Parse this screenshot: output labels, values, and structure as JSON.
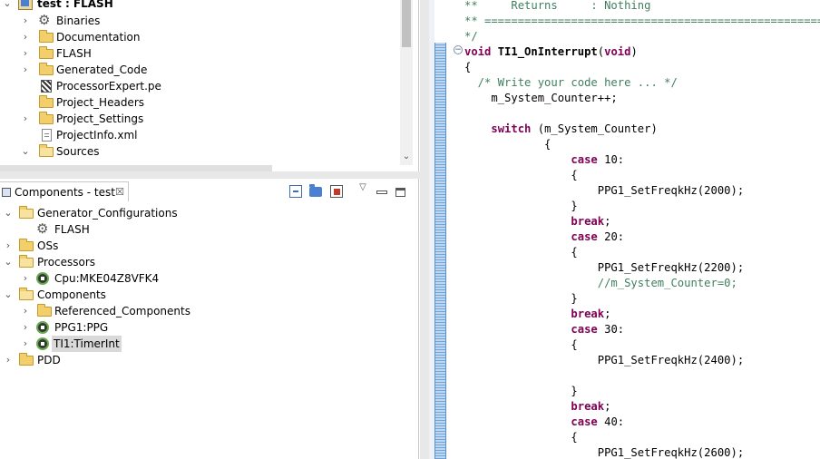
{
  "project_tree": {
    "root": {
      "name": "test",
      "config": ": FLASH"
    },
    "items": [
      {
        "label": "Binaries",
        "icon": "gear-icon"
      },
      {
        "label": "Documentation",
        "icon": "folder-icon"
      },
      {
        "label": "FLASH",
        "icon": "folder-icon"
      },
      {
        "label": "Generated_Code",
        "icon": "folder-icon"
      },
      {
        "label": "ProcessorExpert.pe",
        "icon": "pe-file-icon"
      },
      {
        "label": "Project_Headers",
        "icon": "folder-icon"
      },
      {
        "label": "Project_Settings",
        "icon": "folder-icon"
      },
      {
        "label": "ProjectInfo.xml",
        "icon": "xml-file-icon"
      },
      {
        "label": "Sources",
        "icon": "folder-icon"
      }
    ]
  },
  "components_view": {
    "tab_label": "Components - test",
    "tree": [
      {
        "label": "Generator_Configurations",
        "icon": "folder-icon"
      },
      {
        "label": "FLASH",
        "icon": "gear-icon"
      },
      {
        "label": "OSs",
        "icon": "folder-icon"
      },
      {
        "label": "Processors",
        "icon": "folder-icon"
      },
      {
        "label": "Cpu:MKE04Z8VFK4",
        "icon": "cpu-component-icon"
      },
      {
        "label": "Components",
        "icon": "folder-icon"
      },
      {
        "label": "Referenced_Components",
        "icon": "folder-icon"
      },
      {
        "label": "PPG1:PPG",
        "icon": "ppg-component-icon"
      },
      {
        "label": "TI1:TimerInt",
        "icon": "timer-component-icon",
        "selected": true
      },
      {
        "label": "PDD",
        "icon": "folder-icon"
      }
    ]
  },
  "editor": {
    "lines": [
      "**     Returns     : Nothing",
      "** ===================================================================",
      "*/",
      "void TI1_OnInterrupt(void)",
      "{",
      "  /* Write your code here ... */",
      "    m_System_Counter++;",
      "",
      "    switch (m_System_Counter)",
      "            {",
      "                case 10:",
      "                {",
      "                    PPG1_SetFreqkHz(2000);",
      "                }",
      "                break;",
      "                case 20:",
      "                {",
      "                    PPG1_SetFreqkHz(2200);",
      "                    //m_System_Counter=0;",
      "                }",
      "                break;",
      "                case 30:",
      "                {",
      "                    PPG1_SetFreqkHz(2400);",
      "",
      "                }",
      "                break;",
      "                case 40:",
      "                {",
      "                    PPG1_SetFreqkHz(2600);"
    ]
  },
  "colors": {
    "comment": "#3f7f5f",
    "keyword": "#7f0055",
    "change_bar": "#6ea6d9",
    "selection": "#d9d9d9"
  }
}
